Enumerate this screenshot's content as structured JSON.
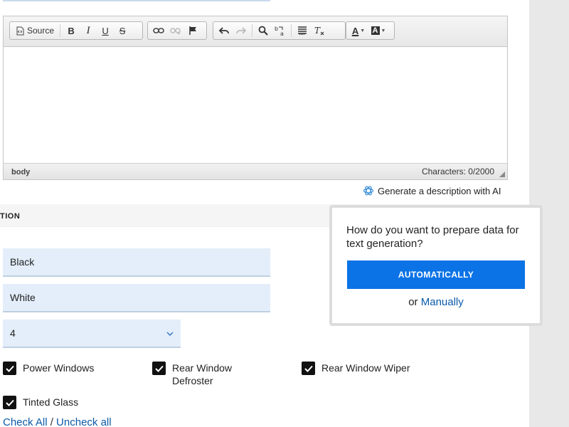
{
  "toolbar": {
    "source_label": "Source",
    "bold_label": "B",
    "italic_label": "I",
    "underline_label": "U",
    "strike_label": "S",
    "text_color_label": "A",
    "bg_color_label": "A"
  },
  "statusbar": {
    "path": "body",
    "char_count": "Characters: 0/2000"
  },
  "ai": {
    "link_label": "Generate a description with AI"
  },
  "section": {
    "title": "TION"
  },
  "fields": {
    "exterior_color": "Black",
    "interior_color": "White",
    "doors_selected": "4"
  },
  "features": [
    {
      "label": "Power Windows",
      "checked": true
    },
    {
      "label": "Rear Window Defroster",
      "checked": true
    },
    {
      "label": "Rear Window Wiper",
      "checked": true
    },
    {
      "label": "Tinted Glass",
      "checked": true
    }
  ],
  "checkall": {
    "check_all": "Check All",
    "separator": " / ",
    "uncheck_all": "Uncheck all"
  },
  "popover": {
    "question": "How do you want to prepare data for text generation?",
    "auto_button": "AUTOMATICALLY",
    "or_text": "or ",
    "manual_link": "Manually"
  },
  "colors": {
    "primary_button": "#0b73e6",
    "link": "#0a5aa8",
    "field_bg": "#e3eefa"
  }
}
